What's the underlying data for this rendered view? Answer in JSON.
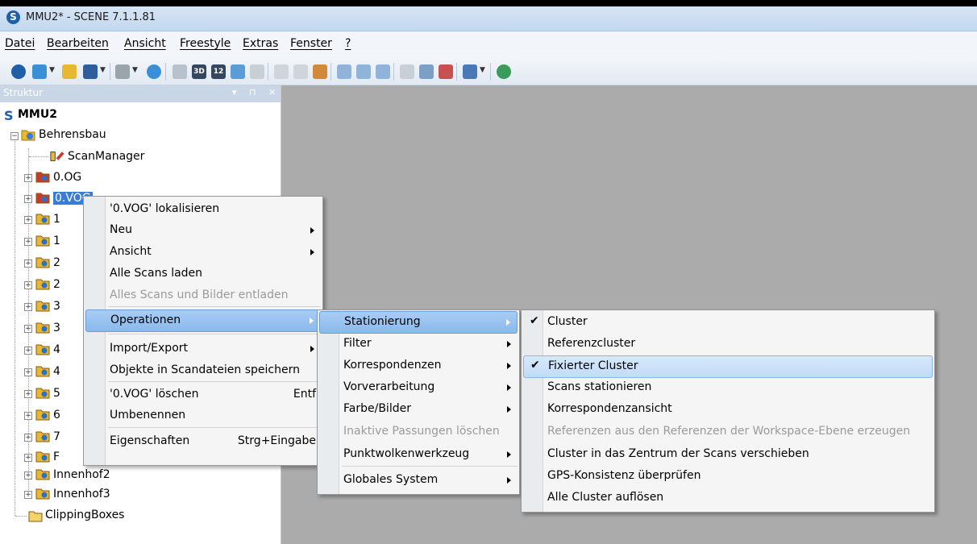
{
  "window": {
    "title": "MMU2* - SCENE 7.1.1.81",
    "app_icon": "S"
  },
  "menubar": [
    "Datei",
    "Bearbeiten",
    "Ansicht",
    "Freestyle",
    "Extras",
    "Fenster",
    "?"
  ],
  "toolbar": {
    "btn_3d": "3D",
    "btn_12": "12"
  },
  "panel": {
    "title": "Struktur",
    "controls": "▾ ⊓ ✕"
  },
  "tree": {
    "root": "MMU2",
    "project": "Behrensbau",
    "items": [
      "ScanManager",
      "0.OG",
      "0.VOG",
      "1",
      "1",
      "2",
      "2",
      "3",
      "3",
      "4",
      "4",
      "5",
      "6",
      "7",
      "F",
      "I",
      "Innenhof2",
      "Innenhof3",
      "ClippingBoxes"
    ]
  },
  "context_menu": {
    "items": [
      {
        "label": "'0.VOG' lokalisieren"
      },
      {
        "label": "Neu",
        "submenu": true
      },
      {
        "label": "Ansicht",
        "submenu": true
      },
      {
        "label": "Alle Scans laden"
      },
      {
        "label": "Alles Scans und Bilder entladen",
        "disabled": true
      },
      {
        "label": "Operationen",
        "submenu": true,
        "highlighted": true
      },
      {
        "label": "Import/Export",
        "submenu": true
      },
      {
        "label": "Objekte in Scandateien speichern"
      },
      {
        "label": "'0.VOG' löschen",
        "shortcut": "Entf"
      },
      {
        "label": "Umbenennen"
      },
      {
        "label": "Eigenschaften",
        "shortcut": "Strg+Eingabe"
      }
    ]
  },
  "operations_menu": {
    "items": [
      {
        "label": "Stationierung",
        "submenu": true,
        "highlighted": true
      },
      {
        "label": "Filter",
        "submenu": true
      },
      {
        "label": "Korrespondenzen",
        "submenu": true
      },
      {
        "label": "Vorverarbeitung",
        "submenu": true
      },
      {
        "label": "Farbe/Bilder",
        "submenu": true
      },
      {
        "label": "Inaktive Passungen löschen",
        "disabled": true
      },
      {
        "label": "Punktwolkenwerkzeug",
        "submenu": true
      },
      {
        "label": "Globales System",
        "submenu": true
      }
    ]
  },
  "stationierung_menu": {
    "items": [
      {
        "label": "Cluster",
        "checked": true
      },
      {
        "label": "Referenzcluster"
      },
      {
        "label": "Fixierter Cluster",
        "checked": true,
        "highlighted": true
      },
      {
        "label": "Scans stationieren"
      },
      {
        "label": "Korrespondenzansicht"
      },
      {
        "label": "Referenzen aus den Referenzen der Workspace-Ebene erzeugen",
        "disabled": true
      },
      {
        "label": "Cluster in das Zentrum der Scans verschieben"
      },
      {
        "label": "GPS-Konsistenz überprüfen"
      },
      {
        "label": "Alle Cluster auflösen"
      }
    ]
  },
  "colors": {
    "workspace": "#ababab",
    "highlight": "#c1dbf8",
    "selection": "#3a7bd5",
    "folder_yellow": "#e8b830",
    "folder_red": "#c83a2a"
  }
}
